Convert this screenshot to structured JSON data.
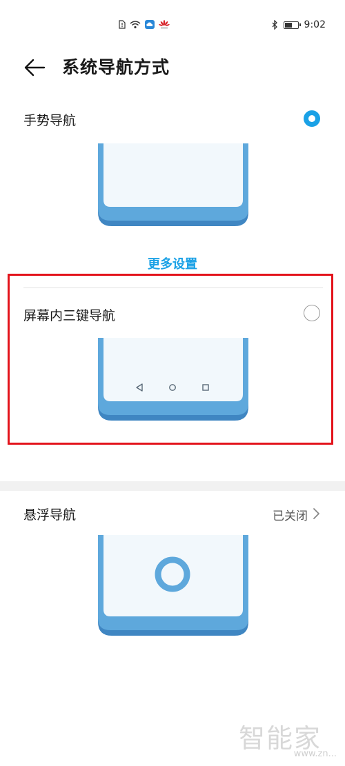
{
  "status_bar": {
    "time": "9:02",
    "icons_left": [
      "sim-alert-icon",
      "wifi-icon",
      "cloud-icon",
      "huawei-logo-icon"
    ],
    "icons_right": [
      "bluetooth-icon",
      "battery-icon"
    ],
    "battery_level": 0.6
  },
  "header": {
    "title": "系统导航方式",
    "back_icon": "back-arrow-icon"
  },
  "options": {
    "gesture": {
      "label": "手势导航",
      "selected": true
    },
    "more_settings": "更多设置",
    "three_key": {
      "label": "屏幕内三键导航",
      "selected": false
    },
    "floating": {
      "label": "悬浮导航",
      "status": "已关闭"
    }
  },
  "colors": {
    "accent": "#1aa1e6",
    "phone_frame": "#5ea8dc",
    "phone_screen": "#f2f8fc",
    "highlight_box": "#e3131b"
  },
  "watermark": {
    "main": "智能家",
    "sub": "www.zn..."
  }
}
